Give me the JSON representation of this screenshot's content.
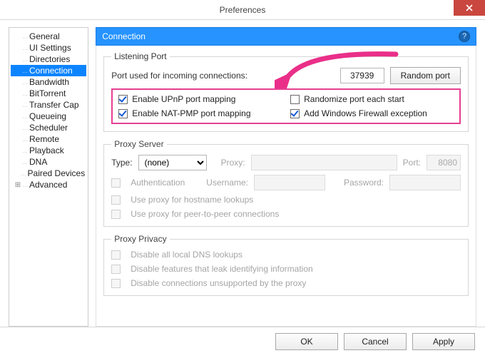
{
  "window": {
    "title": "Preferences"
  },
  "sidebar": {
    "items": [
      "General",
      "UI Settings",
      "Directories",
      "Connection",
      "Bandwidth",
      "BitTorrent",
      "Transfer Cap",
      "Queueing",
      "Scheduler",
      "Remote",
      "Playback",
      "DNA",
      "Paired Devices",
      "Advanced"
    ],
    "selectedIndex": 3,
    "expandableIndex": 13
  },
  "header": {
    "title": "Connection"
  },
  "listeningPort": {
    "legend": "Listening Port",
    "portLabel": "Port used for incoming connections:",
    "portValue": "37939",
    "randomBtn": "Random port",
    "checks": {
      "upnp": {
        "label": "Enable UPnP port mapping",
        "checked": true
      },
      "natpmp": {
        "label": "Enable NAT-PMP port mapping",
        "checked": true
      },
      "randomize": {
        "label": "Randomize port each start",
        "checked": false
      },
      "firewall": {
        "label": "Add Windows Firewall exception",
        "checked": true
      }
    }
  },
  "proxyServer": {
    "legend": "Proxy Server",
    "typeLabel": "Type:",
    "typeValue": "(none)",
    "proxyLabel": "Proxy:",
    "portLabel": "Port:",
    "portValue": "8080",
    "auth": {
      "label": "Authentication"
    },
    "userLabel": "Username:",
    "passLabel": "Password:",
    "hostname": {
      "label": "Use proxy for hostname lookups"
    },
    "p2p": {
      "label": "Use proxy for peer-to-peer connections"
    }
  },
  "proxyPrivacy": {
    "legend": "Proxy Privacy",
    "dns": {
      "label": "Disable all local DNS lookups"
    },
    "leak": {
      "label": "Disable features that leak identifying information"
    },
    "unsupp": {
      "label": "Disable connections unsupported by the proxy"
    }
  },
  "buttons": {
    "ok": "OK",
    "cancel": "Cancel",
    "apply": "Apply"
  }
}
